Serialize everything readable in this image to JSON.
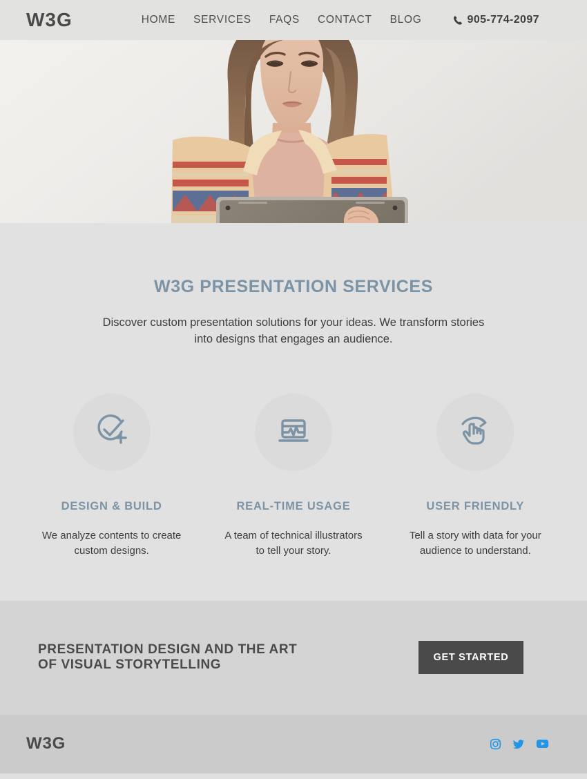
{
  "header": {
    "logo": "W3G",
    "nav": [
      {
        "label": "HOME",
        "name": "nav-link-home"
      },
      {
        "label": "SERVICES",
        "name": "nav-link-services"
      },
      {
        "label": "FAQS",
        "name": "nav-link-faqs"
      },
      {
        "label": "CONTACT",
        "name": "nav-link-contact"
      },
      {
        "label": "BLOG",
        "name": "nav-link-blog"
      }
    ],
    "phone": "905-774-2097",
    "phone_icon": "phone-icon"
  },
  "hero": {
    "alt": "woman holding a tablet against a light wall",
    "image_name": "hero-photo"
  },
  "services": {
    "title": "W3G PRESENTATION SERVICES",
    "subtitle": "Discover custom presentation solutions for your ideas. We transform stories into designs that engages an audience.",
    "features": [
      {
        "icon": "check-circle-plus-icon",
        "title": "DESIGN & BUILD",
        "desc": "We analyze contents to create custom designs."
      },
      {
        "icon": "monitor-pulse-chart-icon",
        "title": "REAL-TIME USAGE",
        "desc": "A team of technical illustrators to tell your story."
      },
      {
        "icon": "hand-swipe-gesture-icon",
        "title": "USER FRIENDLY",
        "desc": "Tell a story with data for your audience to understand."
      }
    ]
  },
  "cta": {
    "line1": "PRESENTATION DESIGN AND THE ART",
    "line2": "OF VISUAL STORYTELLING",
    "button": "GET STARTED"
  },
  "footer": {
    "logo": "W3G",
    "socials": [
      {
        "name": "instagram-icon",
        "label": "Instagram"
      },
      {
        "name": "twitter-icon",
        "label": "Twitter"
      },
      {
        "name": "youtube-icon",
        "label": "YouTube"
      }
    ]
  },
  "colors": {
    "accent_slate": "#7b93a4",
    "header_bg": "#e2e2e0",
    "services_bg": "#e1e1e1",
    "cta_bg": "#d4d4d4",
    "footer_bg": "#cbcbcb",
    "button_dark": "#4a4a4a",
    "social_blue": "#2196e8"
  }
}
